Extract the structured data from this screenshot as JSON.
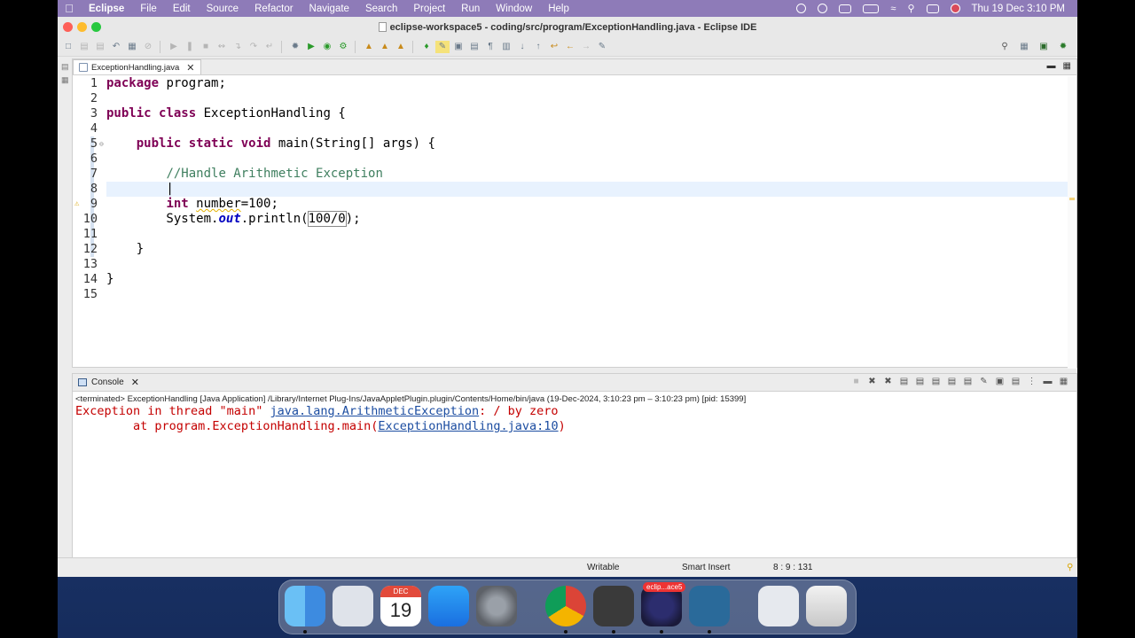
{
  "menubar": {
    "app": "Eclipse",
    "items": [
      "File",
      "Edit",
      "Source",
      "Refactor",
      "Navigate",
      "Search",
      "Project",
      "Run",
      "Window",
      "Help"
    ],
    "clock": "Thu 19 Dec  3:10 PM"
  },
  "window": {
    "title": "eclipse-workspace5 - coding/src/program/ExceptionHandling.java - Eclipse IDE"
  },
  "editor": {
    "tab_label": "ExceptionHandling.java",
    "lines": [
      {
        "n": "1",
        "code": "package program;"
      },
      {
        "n": "2",
        "code": ""
      },
      {
        "n": "3",
        "code": "public class ExceptionHandling {"
      },
      {
        "n": "4",
        "code": ""
      },
      {
        "n": "5",
        "code": "    public static void main(String[] args) {"
      },
      {
        "n": "6",
        "code": ""
      },
      {
        "n": "7",
        "code": "        //Handle Arithmetic Exception"
      },
      {
        "n": "8",
        "code": ""
      },
      {
        "n": "9",
        "code": "        int number=100;"
      },
      {
        "n": "10",
        "code": "        System.out.println(100/0);"
      },
      {
        "n": "11",
        "code": ""
      },
      {
        "n": "12",
        "code": "    }"
      },
      {
        "n": "13",
        "code": ""
      },
      {
        "n": "14",
        "code": "}"
      },
      {
        "n": "15",
        "code": ""
      }
    ]
  },
  "console": {
    "tab_label": "Console",
    "terminated_line": "<terminated> ExceptionHandling [Java Application] /Library/Internet Plug-Ins/JavaAppletPlugin.plugin/Contents/Home/bin/java  (19-Dec-2024, 3:10:23 pm – 3:10:23 pm) [pid: 15399]",
    "out1_prefix": "Exception in thread \"main\" ",
    "out1_link": "java.lang.ArithmeticException",
    "out1_suffix": ": / by zero",
    "out2_prefix": "        at program.ExceptionHandling.main(",
    "out2_link": "ExceptionHandling.java:10",
    "out2_suffix": ")"
  },
  "statusbar": {
    "mode": "Writable",
    "insert": "Smart Insert",
    "position": "8 : 9 : 131"
  },
  "dock": {
    "calendar_month": "DEC",
    "calendar_day": "19",
    "eclipse_badge": "eclip...ace5"
  },
  "colors": {
    "keyword": "#7f0055",
    "comment": "#3f7f5f",
    "error": "#c40000",
    "link": "#1c4da1",
    "menubar": "#8e7bb8"
  }
}
